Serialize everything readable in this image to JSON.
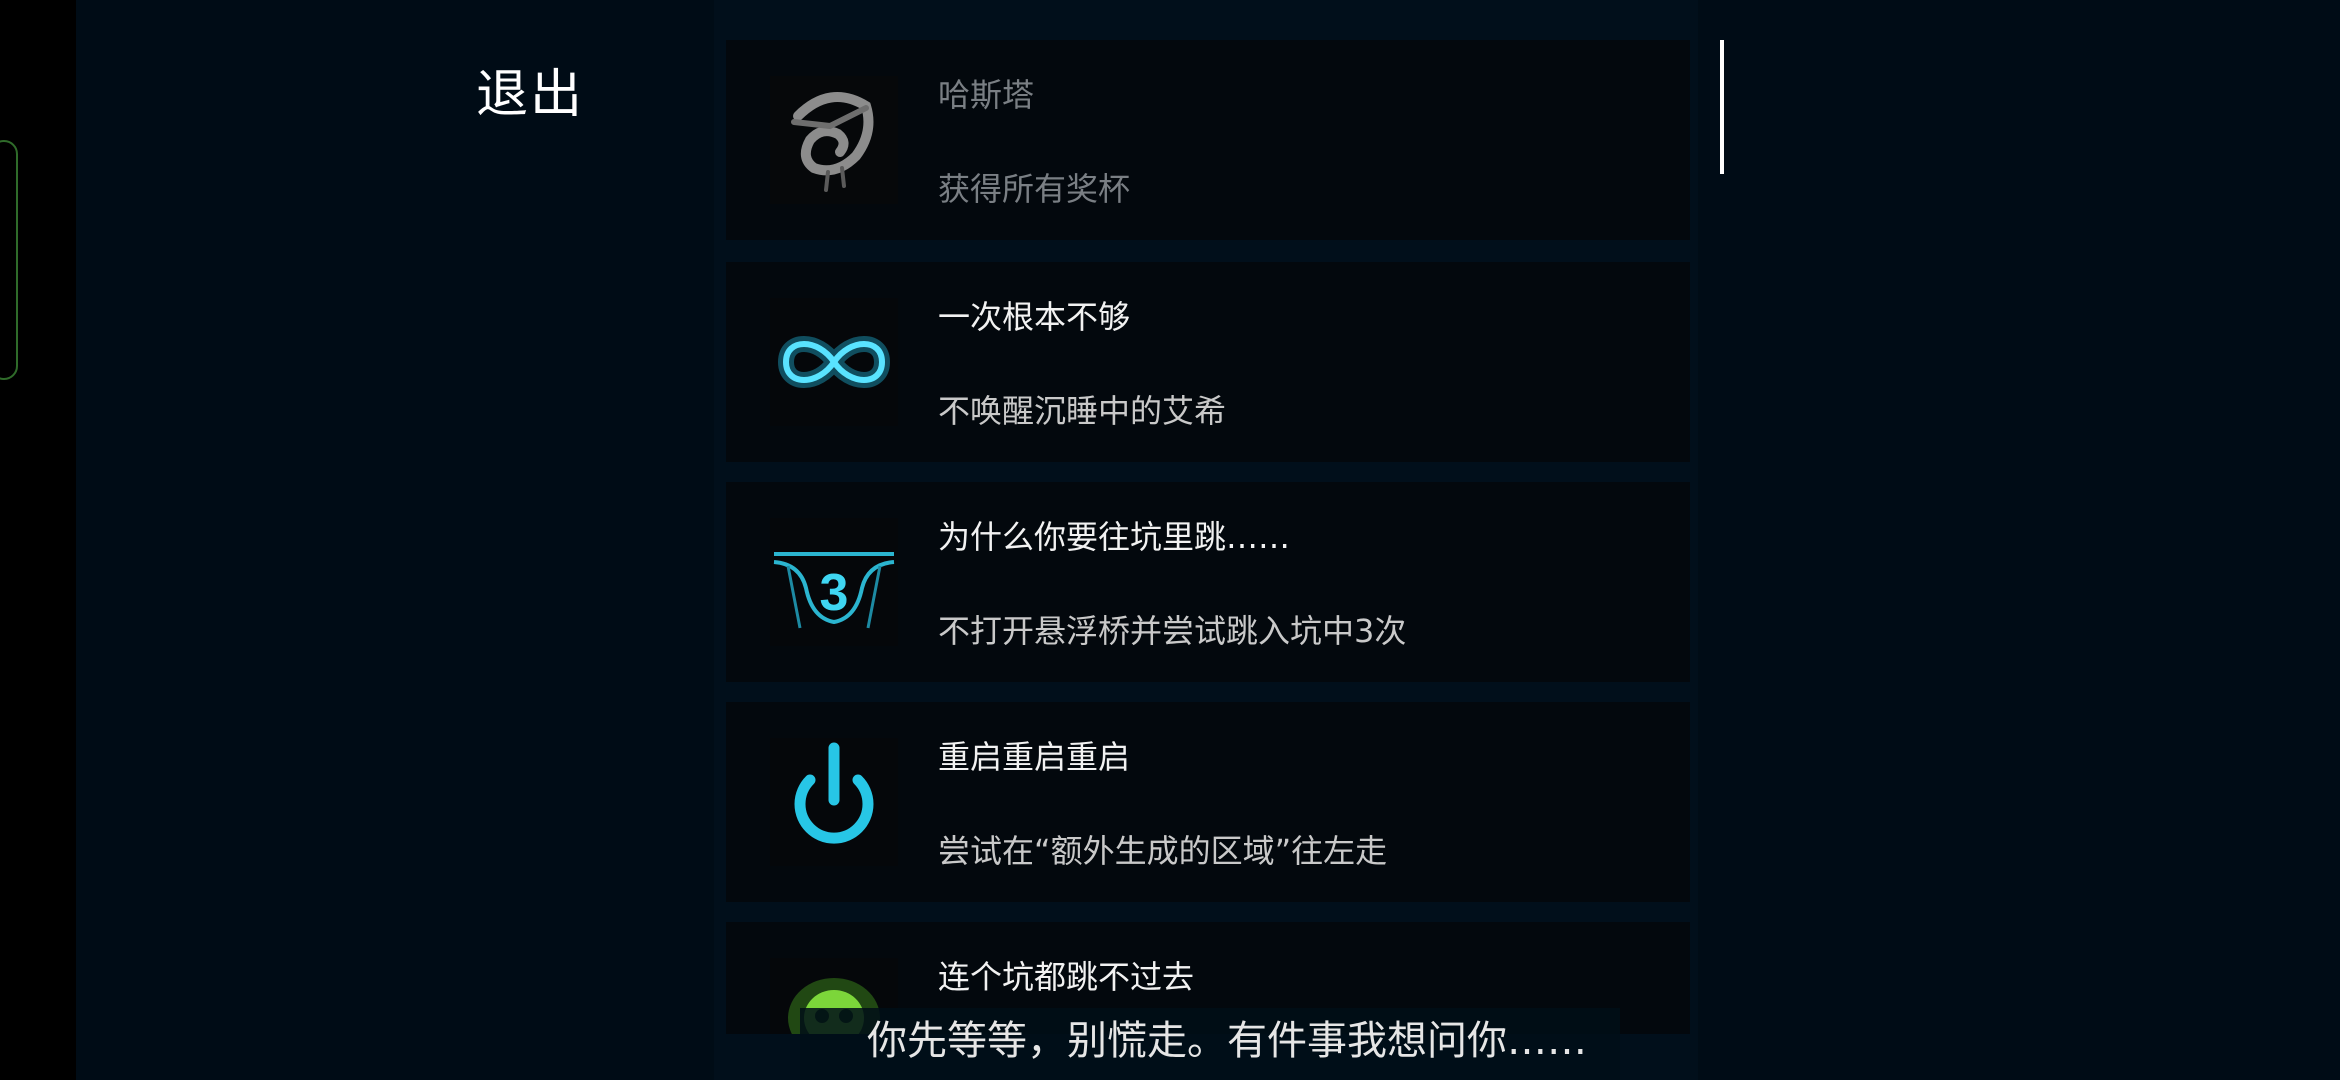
{
  "menu": {
    "exit_label": "退出"
  },
  "achievements": [
    {
      "title": "哈斯塔",
      "description": "获得所有奖杯",
      "icon": "hastur-sigil-icon",
      "locked": true
    },
    {
      "title": "一次根本不够",
      "description": "不唤醒沉睡中的艾希",
      "icon": "infinity-icon",
      "locked": false
    },
    {
      "title": "为什么你要往坑里跳……",
      "description": "不打开悬浮桥并尝试跳入坑中3次",
      "icon": "pit-three-icon",
      "icon_text": "3",
      "locked": false
    },
    {
      "title": "重启重启重启",
      "description": "尝试在“额外生成的区域”往左走",
      "icon": "power-icon",
      "locked": false
    },
    {
      "title": "连个坑都跳不过去",
      "description": "",
      "icon": "green-skull-icon",
      "locked": false
    }
  ],
  "subtitle": "你先等等，别慌走。有件事我想问你……",
  "colors": {
    "background": "#000c16",
    "card": "#03080d",
    "accent_cyan": "#22c8e8",
    "accent_green": "#7cd63a",
    "locked_text": "#7a7f84"
  }
}
